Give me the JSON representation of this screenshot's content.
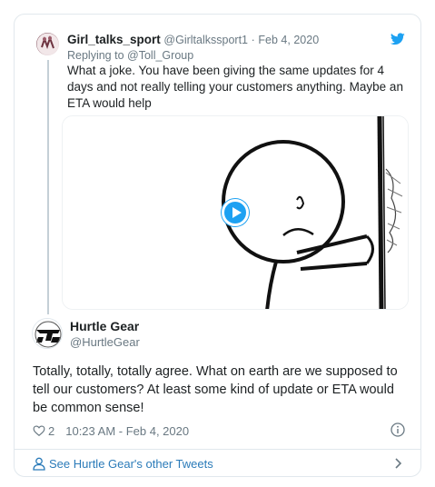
{
  "parent_tweet": {
    "name": "Girl_talks_sport",
    "handle": "@Girltalkssport1",
    "separator": "·",
    "date": "Feb 4, 2020",
    "replying_prefix": "Replying to",
    "replying_to": "@Toll_Group",
    "text": "What a joke. You have been giving the same updates for 4 days and not really telling your customers anything. Maybe an ETA would help"
  },
  "main_tweet": {
    "name": "Hurtle Gear",
    "handle": "@HurtleGear",
    "text": "Totally, totally, totally agree. What on earth are we supposed to tell our customers? At least some kind of update or ETA would be common sense!",
    "likes": "2",
    "timestamp": "10:23 AM - Feb 4, 2020"
  },
  "footer": {
    "label": "See Hurtle Gear's other Tweets"
  },
  "icons": {
    "brand": "twitter-bird-icon",
    "play": "play-icon",
    "like": "heart-icon",
    "info": "info-icon",
    "person": "person-icon",
    "chevron": "chevron-right-icon"
  },
  "colors": {
    "accent": "#1da1f2",
    "link": "#2b7bb9",
    "muted": "#697882",
    "text": "#1c2022",
    "border": "#e1e8ed"
  }
}
